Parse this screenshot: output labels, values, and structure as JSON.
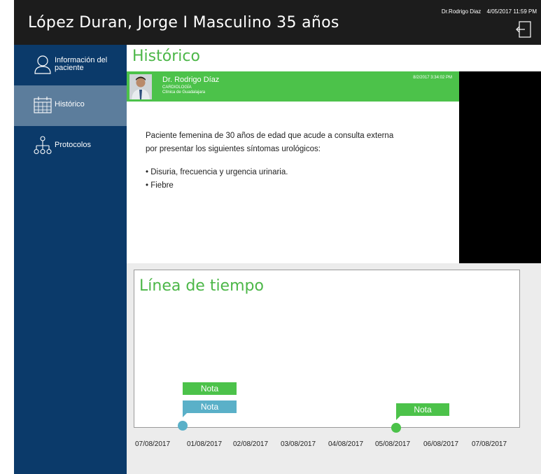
{
  "header": {
    "patient_title": "López  Duran, Jorge I Masculino 35 años",
    "doctor": "Dr.Rodrigo Diaz",
    "datetime": "4/05/2017 11:59 PM",
    "logout_icon": "logout-icon"
  },
  "sidebar": {
    "items": [
      {
        "label": "Información del paciente",
        "icon": "user-icon",
        "active": false
      },
      {
        "label": "Histórico",
        "icon": "calendar-icon",
        "active": true
      },
      {
        "label": "Protocolos",
        "icon": "hierarchy-icon",
        "active": false
      }
    ]
  },
  "main": {
    "title": "Histórico",
    "note": {
      "doctor_name": "Dr. Rodrigo Díaz",
      "specialty": "CARDIOLOGÍA",
      "clinic": "Clínica de Guadalajara",
      "date": "8/2/2017 3:34:02 PM",
      "line1": "Paciente femenina de 30 años de edad que acude a consulta externa",
      "line2": "por presentar los siguientes síntomas urológicos:",
      "bullet1": "• Disuria, frecuencia y urgencia urinaria.",
      "bullet2": "• Fiebre"
    }
  },
  "timeline": {
    "title": "Línea de tiempo",
    "tag_label": "Nota",
    "dates": [
      "07/08/2017",
      "01/08/2017",
      "02/08/2017",
      "03/08/2017",
      "04/08/2017",
      "05/08/2017",
      "06/08/2017",
      "07/08/2017"
    ],
    "colors": {
      "green": "#4cc24a",
      "teal": "#5ab0c8"
    }
  }
}
